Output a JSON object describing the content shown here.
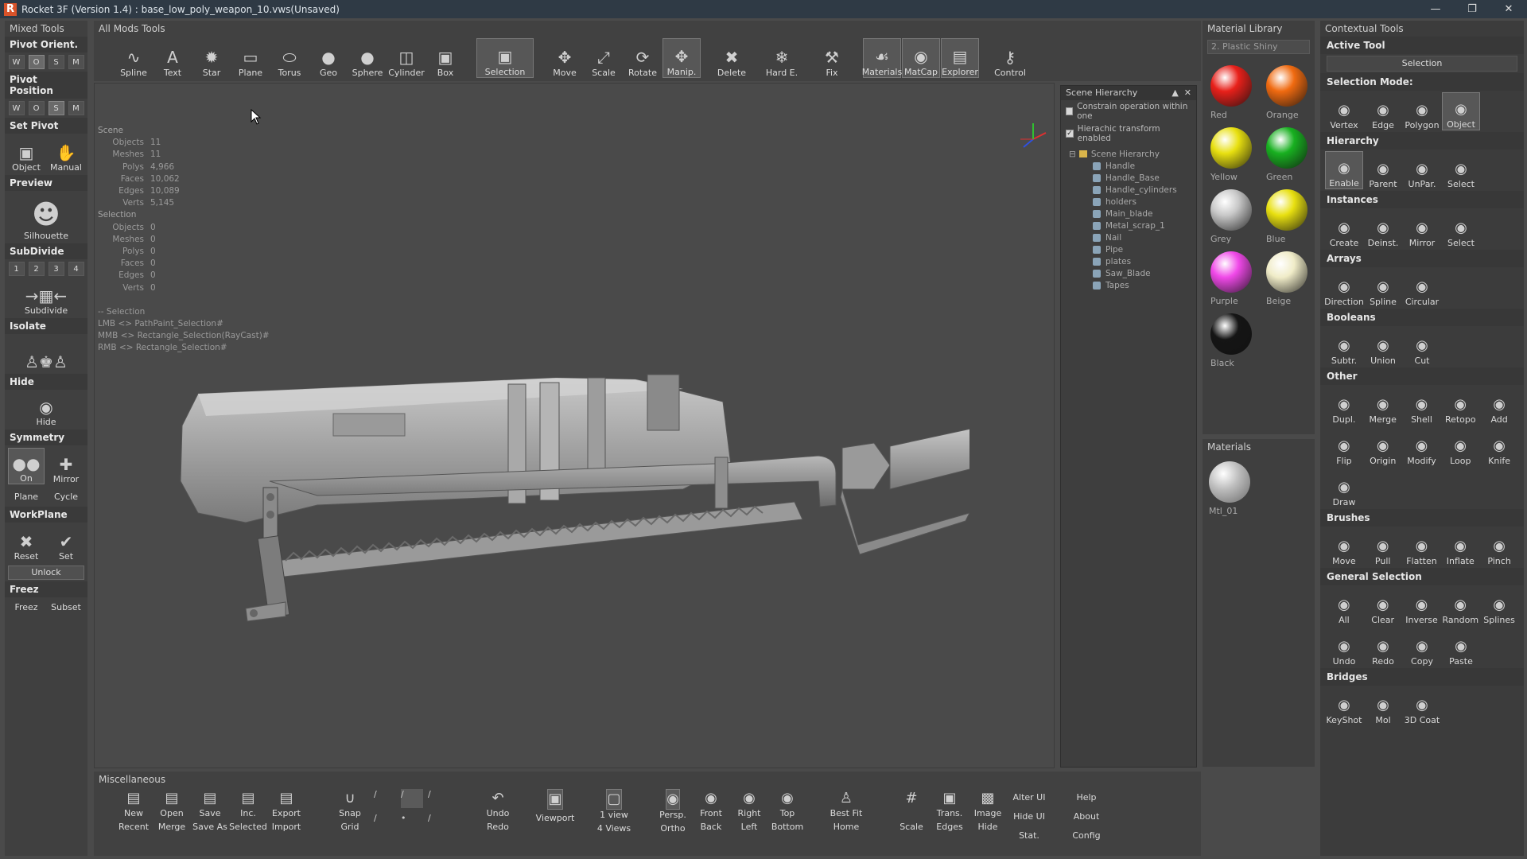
{
  "window": {
    "title": "Rocket 3F (Version 1.4) : base_low_poly_weapon_10.vws(Unsaved)",
    "logo": "R"
  },
  "left": {
    "title": "Mixed Tools",
    "pivot_orient": {
      "label": "Pivot Orient.",
      "opts": [
        "W",
        "O",
        "S",
        "M"
      ],
      "active": "O"
    },
    "pivot_position": {
      "label": "Pivot Position",
      "opts": [
        "W",
        "O",
        "S",
        "M"
      ],
      "active": "S"
    },
    "set_pivot": {
      "label": "Set Pivot",
      "object": "Object",
      "manual": "Manual"
    },
    "preview": {
      "label": "Preview",
      "silhouette": "Silhouette"
    },
    "subdivide": {
      "label": "SubDivide",
      "levels": [
        "1",
        "2",
        "3",
        "4"
      ],
      "button": "Subdivide"
    },
    "isolate": {
      "label": "Isolate"
    },
    "hide": {
      "label": "Hide",
      "button": "Hide"
    },
    "symmetry": {
      "label": "Symmetry",
      "on": "On",
      "mirror": "Mirror",
      "plane": "Plane",
      "cycle": "Cycle"
    },
    "workplane": {
      "label": "WorkPlane",
      "reset": "Reset",
      "set": "Set",
      "unlock": "Unlock"
    },
    "freez": {
      "label": "Freez",
      "freez": "Freez",
      "subset": "Subset"
    }
  },
  "mods": {
    "title": "All Mods Tools",
    "tools": [
      "Spline",
      "Text",
      "Star",
      "Plane",
      "Torus",
      "Geo",
      "Sphere",
      "Cylinder",
      "Box"
    ],
    "selection": "Selection",
    "transform": [
      "Move",
      "Scale",
      "Rotate",
      "Manip."
    ],
    "delete": "Delete",
    "harde": "Hard E.",
    "fix": "Fix",
    "views": [
      "Materials",
      "MatCap",
      "Explorer"
    ],
    "control": "Control"
  },
  "stats": {
    "scene": "Scene",
    "scene_rows": [
      {
        "k": "Objects",
        "v": "11"
      },
      {
        "k": "Meshes",
        "v": "11"
      },
      {
        "k": "Polys",
        "v": "4,966"
      },
      {
        "k": "Faces",
        "v": "10,062"
      },
      {
        "k": "Edges",
        "v": "10,089"
      },
      {
        "k": "Verts",
        "v": "5,145"
      }
    ],
    "selection": "Selection",
    "sel_rows": [
      {
        "k": "Objects",
        "v": "0"
      },
      {
        "k": "Meshes",
        "v": "0"
      },
      {
        "k": "Polys",
        "v": "0"
      },
      {
        "k": "Faces",
        "v": "0"
      },
      {
        "k": "Edges",
        "v": "0"
      },
      {
        "k": "Verts",
        "v": "0"
      }
    ],
    "keys": [
      "-- Selection",
      "LMB <> PathPaint_Selection#",
      "MMB <> Rectangle_Selection(RayCast)#",
      "RMB <> Rectangle_Selection#"
    ]
  },
  "hierarchy": {
    "title": "Scene Hierarchy",
    "opt1": "Constrain operation within one",
    "opt2": "Hierachic transform enabled",
    "root": "Scene Hierarchy",
    "items": [
      "Handle",
      "Handle_Base",
      "Handle_cylinders",
      "holders",
      "Main_blade",
      "Metal_scrap_1",
      "Nail",
      "Pipe",
      "plates",
      "Saw_Blade",
      "Tapes"
    ]
  },
  "matlib": {
    "title": "Material Library",
    "preset": "2. Plastic Shiny",
    "balls": [
      {
        "name": "Red",
        "color": "#e8201a"
      },
      {
        "name": "Orange",
        "color": "#f06a10"
      },
      {
        "name": "Yellow",
        "color": "#e8e010"
      },
      {
        "name": "Green",
        "color": "#18b020"
      },
      {
        "name": "Grey",
        "color": "#c8c8c8"
      },
      {
        "name": "Blue",
        "color": "#e8e010"
      },
      {
        "name": "Purple",
        "color": "#f048e8"
      },
      {
        "name": "Beige",
        "color": "#f0ecc8"
      },
      {
        "name": "Black",
        "color": "#151515"
      }
    ]
  },
  "materials": {
    "title": "Materials",
    "item": "Mtl_01"
  },
  "ctx": {
    "title": "Contextual Tools",
    "active_tool": "Active Tool",
    "selection_btn": "Selection",
    "selection_mode": "Selection Mode:",
    "modes": [
      "Vertex",
      "Edge",
      "Polygon",
      "Object"
    ],
    "hierarchy": "Hierarchy",
    "hier_btns": [
      "Enable",
      "Parent",
      "UnPar.",
      "Select"
    ],
    "instances": "Instances",
    "inst_btns": [
      "Create",
      "Deinst.",
      "Mirror",
      "Select"
    ],
    "arrays": "Arrays",
    "arr_btns": [
      "Direction",
      "Spline",
      "Circular"
    ],
    "booleans": "Booleans",
    "bool_btns": [
      "Subtr.",
      "Union",
      "Cut"
    ],
    "other": "Other",
    "other_btns1": [
      "Dupl.",
      "Merge",
      "Shell",
      "Retopo",
      "Add"
    ],
    "other_btns2": [
      "Flip",
      "Origin",
      "Modify",
      "Loop",
      "Knife"
    ],
    "other_btns3": [
      "Draw"
    ],
    "brushes": "Brushes",
    "brush_btns": [
      "Move",
      "Pull",
      "Flatten",
      "Inflate",
      "Pinch"
    ],
    "gensel": "General Selection",
    "gs_btns1": [
      "All",
      "Clear",
      "Inverse",
      "Random",
      "Splines"
    ],
    "gs_btns2": [
      "Undo",
      "Redo",
      "Copy",
      "Paste"
    ],
    "bridges": "Bridges",
    "bridge_btns": [
      "KeyShot",
      "Mol",
      "3D Coat"
    ]
  },
  "misc": {
    "title": "Miscellaneous",
    "file_top": [
      "New",
      "Open",
      "Save",
      "Inc.",
      "Export"
    ],
    "file_bot": [
      "Recent",
      "Merge",
      "Save As",
      "Selected",
      "Import"
    ],
    "snap": "Snap",
    "grid": "Grid",
    "undo": "Undo",
    "redo": "Redo",
    "viewport": "Viewport",
    "oneview": "1 view",
    "fourviews": "4 Views",
    "views_top": [
      "Persp.",
      "Front",
      "Right",
      "Top"
    ],
    "views_bot": [
      "Ortho",
      "Back",
      "Left",
      "Bottom"
    ],
    "bestfit": "Best Fit",
    "home": "Home",
    "disp_top": [
      "Trans.",
      "Image"
    ],
    "disp_bot": [
      "Scale",
      "Edges",
      "Hide"
    ],
    "alter": [
      "Alter UI",
      "Hide UI",
      "Stat."
    ],
    "help": [
      "Help",
      "About",
      "Config"
    ]
  }
}
